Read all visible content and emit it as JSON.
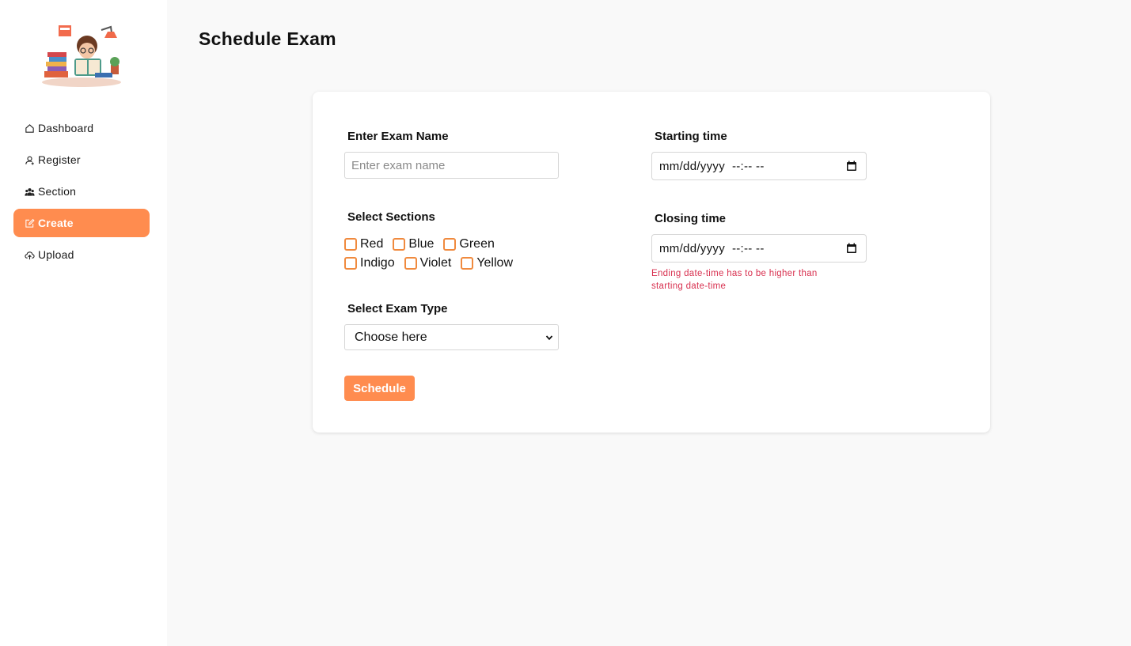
{
  "sidebar": {
    "items": [
      {
        "label": "Dashboard",
        "icon": "home-icon",
        "active": false
      },
      {
        "label": "Register",
        "icon": "user-add-icon",
        "active": false
      },
      {
        "label": "Section",
        "icon": "team-icon",
        "active": false
      },
      {
        "label": "Create",
        "icon": "edit-icon",
        "active": true
      },
      {
        "label": "Upload",
        "icon": "cloud-upload-icon",
        "active": false
      }
    ]
  },
  "header": {
    "title": "Schedule Exam"
  },
  "form": {
    "exam_name": {
      "label": "Enter Exam Name",
      "placeholder": "Enter exam name",
      "value": ""
    },
    "sections": {
      "label": "Select Sections",
      "options": [
        "Red",
        "Blue",
        "Green",
        "Indigo",
        "Violet",
        "Yellow"
      ]
    },
    "exam_type": {
      "label": "Select Exam Type",
      "value": "Choose here"
    },
    "starting_time": {
      "label": "Starting time",
      "value": "mm/dd/yyyy  --:-- --"
    },
    "closing_time": {
      "label": "Closing time",
      "value": "mm/dd/yyyy  --:-- --",
      "error": "Ending date-time has to be higher than starting date-time"
    },
    "submit_label": "Schedule"
  },
  "colors": {
    "accent": "#ff8c4f",
    "error": "#d8304f",
    "checkbox_border": "#f08a3e"
  }
}
